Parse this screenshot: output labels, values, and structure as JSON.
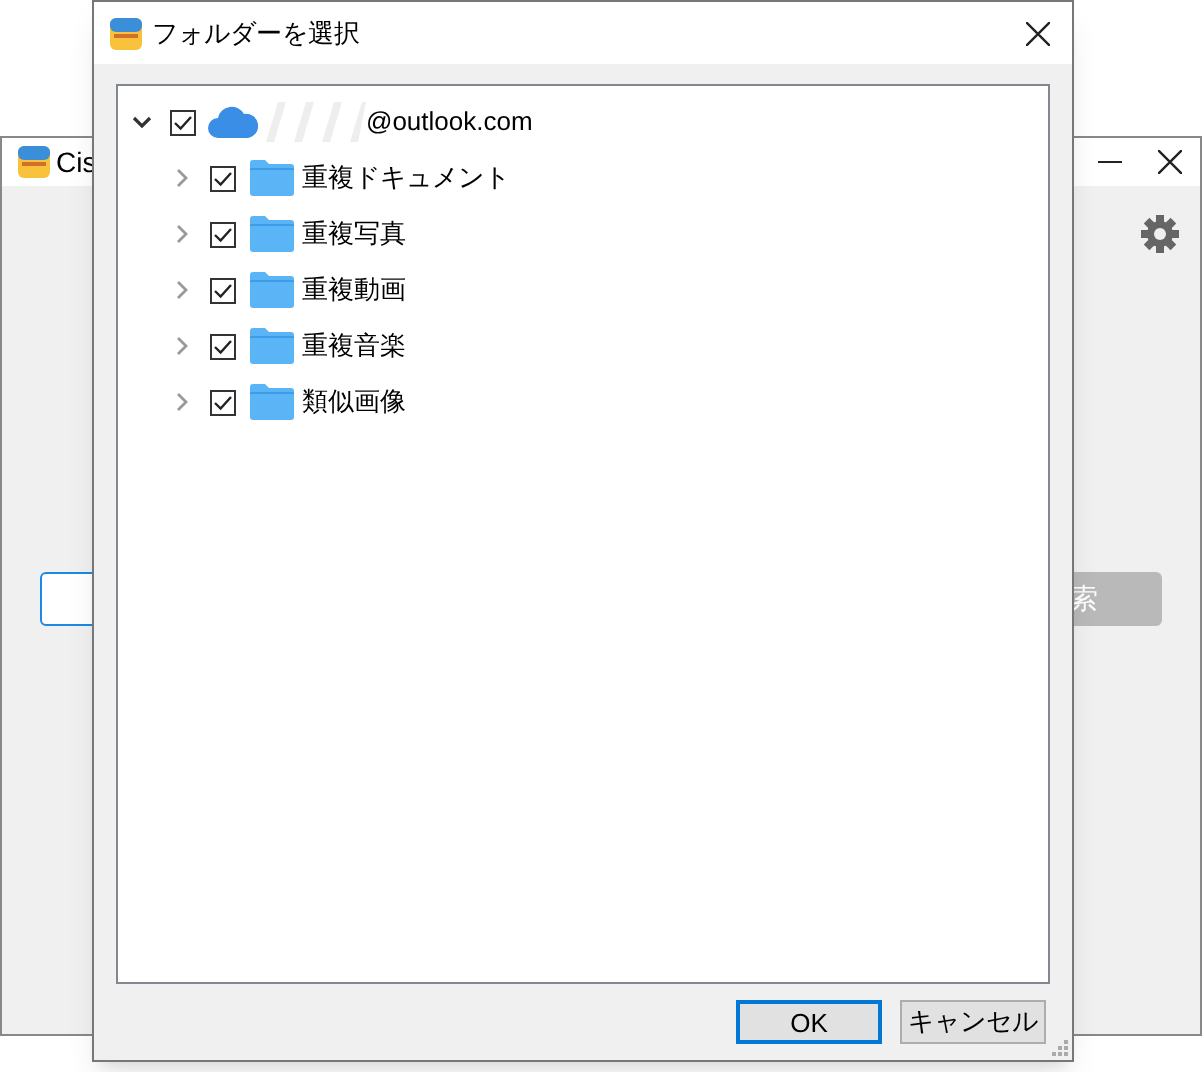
{
  "background_window": {
    "title": "Cis",
    "search_button": "索"
  },
  "dialog": {
    "title": "フォルダーを選択",
    "tree": [
      {
        "label": "@outlook.com",
        "kind": "cloud",
        "checked": true,
        "expanded": true,
        "children": [
          {
            "label": "重複ドキュメント",
            "kind": "folder",
            "checked": true,
            "expanded": false
          },
          {
            "label": "重複写真",
            "kind": "folder",
            "checked": true,
            "expanded": false
          },
          {
            "label": "重複動画",
            "kind": "folder",
            "checked": true,
            "expanded": false
          },
          {
            "label": "重複音楽",
            "kind": "folder",
            "checked": true,
            "expanded": false
          },
          {
            "label": "類似画像",
            "kind": "folder",
            "checked": true,
            "expanded": false
          }
        ]
      }
    ],
    "buttons": [
      {
        "label": "OK",
        "default": true
      },
      {
        "label": "キャンセル",
        "default": false
      }
    ]
  }
}
